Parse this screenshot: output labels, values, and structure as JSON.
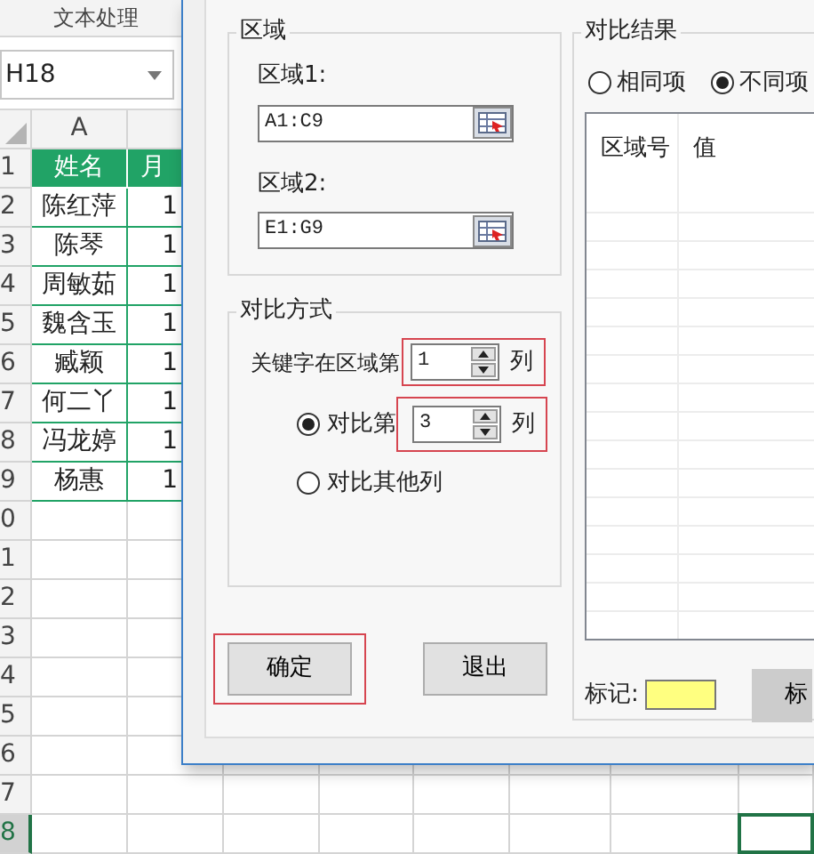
{
  "ribbon": {
    "group_label": "文本处理"
  },
  "name_box": {
    "value": "H18"
  },
  "sheet": {
    "columns": [
      "A"
    ],
    "rows": [
      {
        "number": "1",
        "kind": "header",
        "selected": false,
        "cells": [
          "姓名",
          "月"
        ]
      },
      {
        "number": "2",
        "kind": "data",
        "selected": false,
        "cells": [
          "陈红萍",
          "1"
        ]
      },
      {
        "number": "3",
        "kind": "data",
        "selected": false,
        "cells": [
          "陈琴",
          "1"
        ]
      },
      {
        "number": "4",
        "kind": "data",
        "selected": false,
        "cells": [
          "周敏茹",
          "1"
        ]
      },
      {
        "number": "5",
        "kind": "data",
        "selected": false,
        "cells": [
          "魏含玉",
          "1"
        ]
      },
      {
        "number": "6",
        "kind": "data",
        "selected": false,
        "cells": [
          "臧颖",
          "1"
        ]
      },
      {
        "number": "7",
        "kind": "data",
        "selected": false,
        "cells": [
          "何二丫",
          "1"
        ]
      },
      {
        "number": "8",
        "kind": "data",
        "selected": false,
        "cells": [
          "冯龙婷",
          "1"
        ]
      },
      {
        "number": "9",
        "kind": "data",
        "selected": false,
        "cells": [
          "杨惠",
          "1"
        ]
      },
      {
        "number": "0",
        "kind": "empty",
        "selected": false
      },
      {
        "number": "1",
        "kind": "empty",
        "selected": false
      },
      {
        "number": "2",
        "kind": "empty",
        "selected": false
      },
      {
        "number": "3",
        "kind": "empty",
        "selected": false
      },
      {
        "number": "4",
        "kind": "empty",
        "selected": false
      },
      {
        "number": "5",
        "kind": "empty",
        "selected": false
      },
      {
        "number": "6",
        "kind": "empty",
        "selected": false
      },
      {
        "number": "7",
        "kind": "empty",
        "selected": false
      },
      {
        "number": "8",
        "kind": "empty",
        "selected": true
      }
    ]
  },
  "dialog": {
    "region_group": {
      "title": "区域",
      "fields": [
        {
          "label": "区域1:",
          "value": "A1:C9"
        },
        {
          "label": "区域2:",
          "value": "E1:G9"
        }
      ]
    },
    "method_group": {
      "title": "对比方式",
      "key_label": "关键字在区域第",
      "key_value": "1",
      "key_unit": "列",
      "key_highlighted": true,
      "options": [
        {
          "label": "对比第",
          "selected": true,
          "value": "3",
          "unit": "列",
          "highlighted": true
        },
        {
          "label": "对比其他列",
          "selected": false
        }
      ]
    },
    "buttons": [
      {
        "label": "确定",
        "highlighted": true
      },
      {
        "label": "退出",
        "highlighted": false
      }
    ],
    "result_group": {
      "title": "对比结果",
      "options": [
        {
          "label": "相同项",
          "selected": false
        },
        {
          "label": "不同项",
          "selected": true
        }
      ],
      "columns": [
        "区域号",
        "值"
      ],
      "mark_label": "标记:",
      "mark_swatch": {
        "color": "#ffff80"
      },
      "mark_button": "标"
    }
  }
}
